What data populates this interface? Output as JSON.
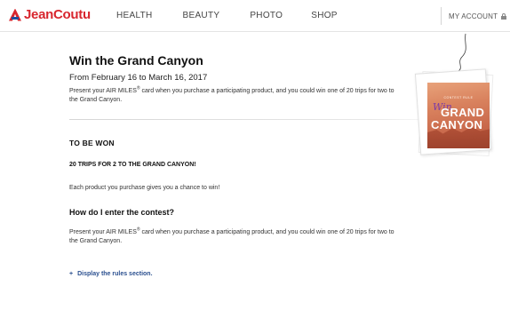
{
  "header": {
    "logo_text": "JeanCoutu",
    "nav": [
      "HEALTH",
      "BEAUTY",
      "PHOTO",
      "SHOP"
    ],
    "account_label": "MY ACCOUNT"
  },
  "main": {
    "title": "Win the Grand Canyon",
    "dates": "From February 16 to March 16, 2017",
    "intro_before": "Present your AIR  MILES",
    "intro_sup": "®",
    "intro_after": " card when you purchase a participating product, and you could win one of 20 trips for two to the Grand Canyon."
  },
  "prize": {
    "heading": "TO BE WON",
    "line": "20 TRIPS FOR 2 TO THE GRAND CANYON!",
    "chance": "Each product you purchase gives you a chance to win!"
  },
  "how": {
    "title": "How do I enter the contest?",
    "text_before": "Present your AIR  MILES",
    "text_sup": "®",
    "text_after": " card when you purchase a participating product, and you could win one of 20 trips for two to the Grand Canyon."
  },
  "rules": {
    "plus": "+",
    "label": "Display the rules section."
  },
  "tag": {
    "contest_line": "CONTEST RULE",
    "win": "Win",
    "grand": "GRAND",
    "canyon": "CANYON"
  },
  "colors": {
    "brand_red": "#d8262e",
    "brand_blue": "#1f4f9e",
    "link_blue": "#2a4f8f"
  }
}
